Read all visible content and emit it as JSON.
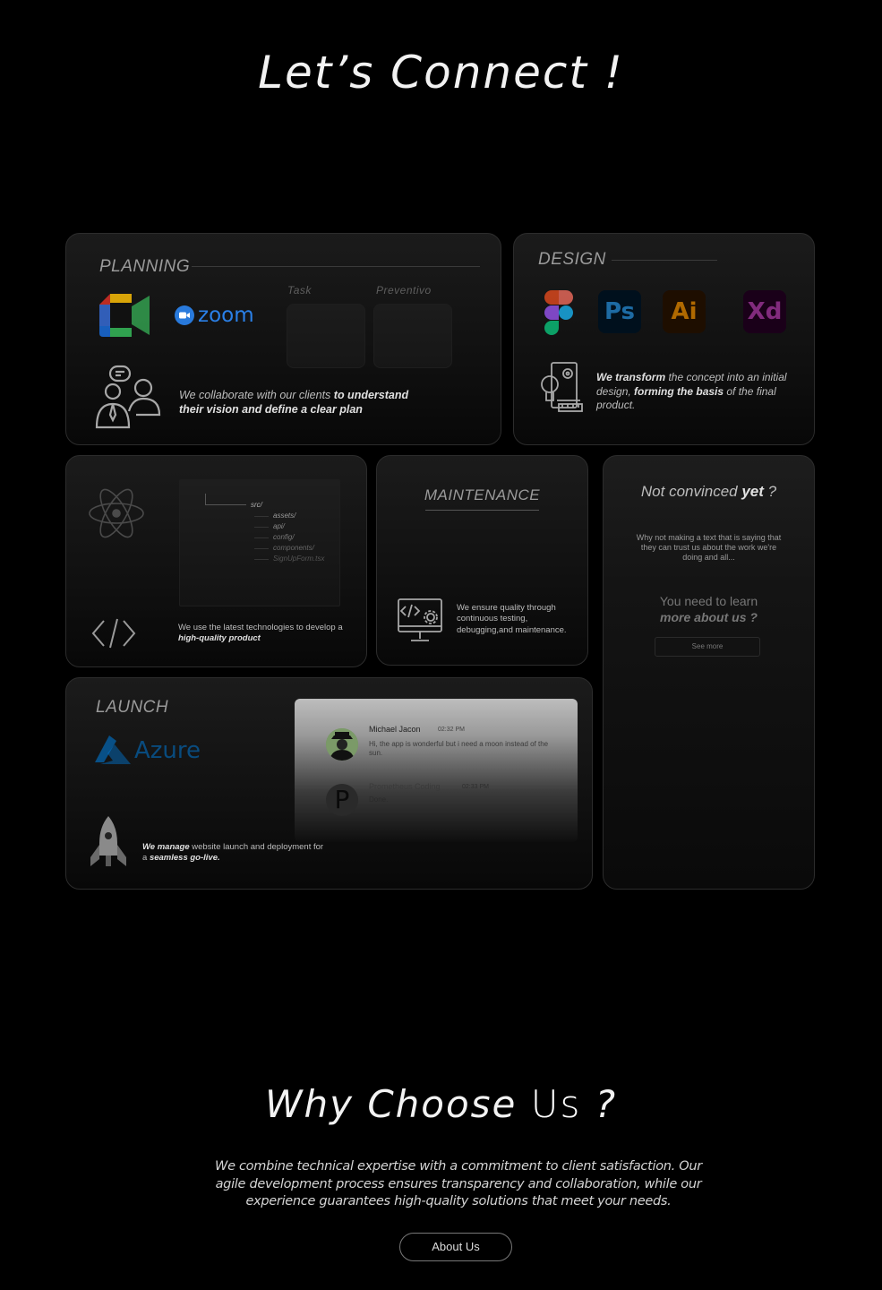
{
  "header": {
    "title": "Let’s Connect !"
  },
  "planning": {
    "title": "PLANNING",
    "tile_task": "Task",
    "tile_preventivo": "Preventivo",
    "zoom_label": "zoom",
    "desc_1": "We collaborate with our clients ",
    "desc_2": "to understand their vision and define a clear plan"
  },
  "design": {
    "title": "DESIGN",
    "apps": {
      "ps": "Ps",
      "ai": "Ai",
      "xd": "Xd"
    },
    "desc_b1": "We transform",
    "desc_1": " the concept into an initial design, ",
    "desc_b2": "forming the basis",
    "desc_2": " of the final product."
  },
  "develop": {
    "tree": [
      "src/",
      "assets/",
      "api/",
      "config/",
      "components/",
      "SignUpForm.tsx"
    ],
    "code_icon": "</>",
    "desc_1": "We use the latest technologies to develop a ",
    "desc_b": "high-quality product"
  },
  "maintenance": {
    "title": "MAINTENANCE",
    "desc": "We ensure quality through continuous testing, debugging,and maintenance."
  },
  "notconvinced": {
    "title_1": "Not convinced ",
    "title_b": "yet",
    "title_2": " ?",
    "text": "Why not making a text that is saying that they can trust us about the work we're doing and all...",
    "learn_1": "You need to learn",
    "learn_b": "more about us ?",
    "button": "See more"
  },
  "launch": {
    "title": "LAUNCH",
    "azure": "Azure",
    "chat": {
      "name_1": "Michael Jacon",
      "time_1": "02:32 PM",
      "msg_1": "Hi, the app is wonderful but i need a moon instead of the sun.",
      "name_2": "Prometheus Coding",
      "time_2": "02:33 PM",
      "msg_2": "Done.",
      "avatar_2": "P"
    },
    "desc_b1": "We manage",
    "desc_1": " website launch and deployment for a ",
    "desc_b2": "seamless go-live."
  },
  "why": {
    "title_1": "Why Choose ",
    "title_b": "Us",
    "title_2": " ?",
    "text": "We combine technical expertise with a commitment to client satisfaction. Our agile development process ensures transparency and collaboration, while our experience guarantees high-quality solutions that meet your needs.",
    "button": "About Us"
  },
  "colors": {
    "ps": "#31a8ff",
    "ai": "#ff9a00",
    "xd": "#ff61f6",
    "azure": "#0078d4",
    "zoom": "#2d8cff"
  }
}
